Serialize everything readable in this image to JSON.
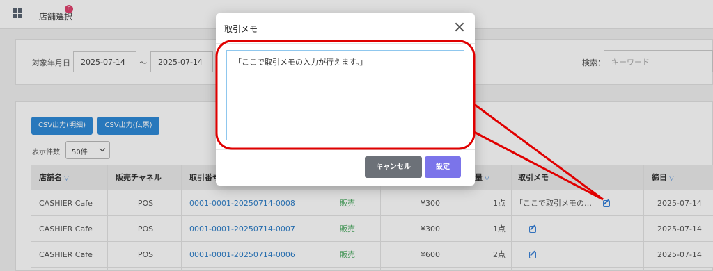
{
  "topbar": {
    "store_select": "店舗選択",
    "badge": "6"
  },
  "filter": {
    "date_label": "対象年月日",
    "date_from": "2025-07-14",
    "tilde": "～",
    "date_to": "2025-07-14",
    "search_label": "検索：",
    "search_placeholder": "キーワード"
  },
  "toolbar": {
    "csv_detail": "CSV出力(明細)",
    "csv_slip": "CSV出力(伝票)",
    "per_page_label": "表示件数",
    "per_page_value": "50件"
  },
  "table": {
    "headers": {
      "store": "店舗名",
      "channel": "販売チャネル",
      "txn": "取引番号",
      "qty": "量",
      "memo": "取引メモ",
      "closing": "締日"
    },
    "rows": [
      {
        "store": "CASHIER Cafe",
        "channel": "POS",
        "txn": "0001-0001-20250714-0008",
        "type": "販売",
        "amount": "¥300",
        "qty": "1点",
        "memo": "「ここで取引メモの…",
        "closing": "2025-07-14"
      },
      {
        "store": "CASHIER Cafe",
        "channel": "POS",
        "txn": "0001-0001-20250714-0007",
        "type": "販売",
        "amount": "¥300",
        "qty": "1点",
        "memo": "",
        "closing": "2025-07-14"
      },
      {
        "store": "CASHIER Cafe",
        "channel": "POS",
        "txn": "0001-0001-20250714-0006",
        "type": "販売",
        "amount": "¥600",
        "qty": "2点",
        "memo": "",
        "closing": "2025-07-14"
      }
    ]
  },
  "modal": {
    "title": "取引メモ",
    "memo_text": "「ここで取引メモの入力が行えます。」",
    "cancel_label": "キャンセル",
    "set_label": "設定"
  },
  "colors": {
    "accent": "#2f8ad8",
    "callout": "#e00000",
    "confirm": "#7b74ea",
    "cancel": "#6c7178"
  }
}
